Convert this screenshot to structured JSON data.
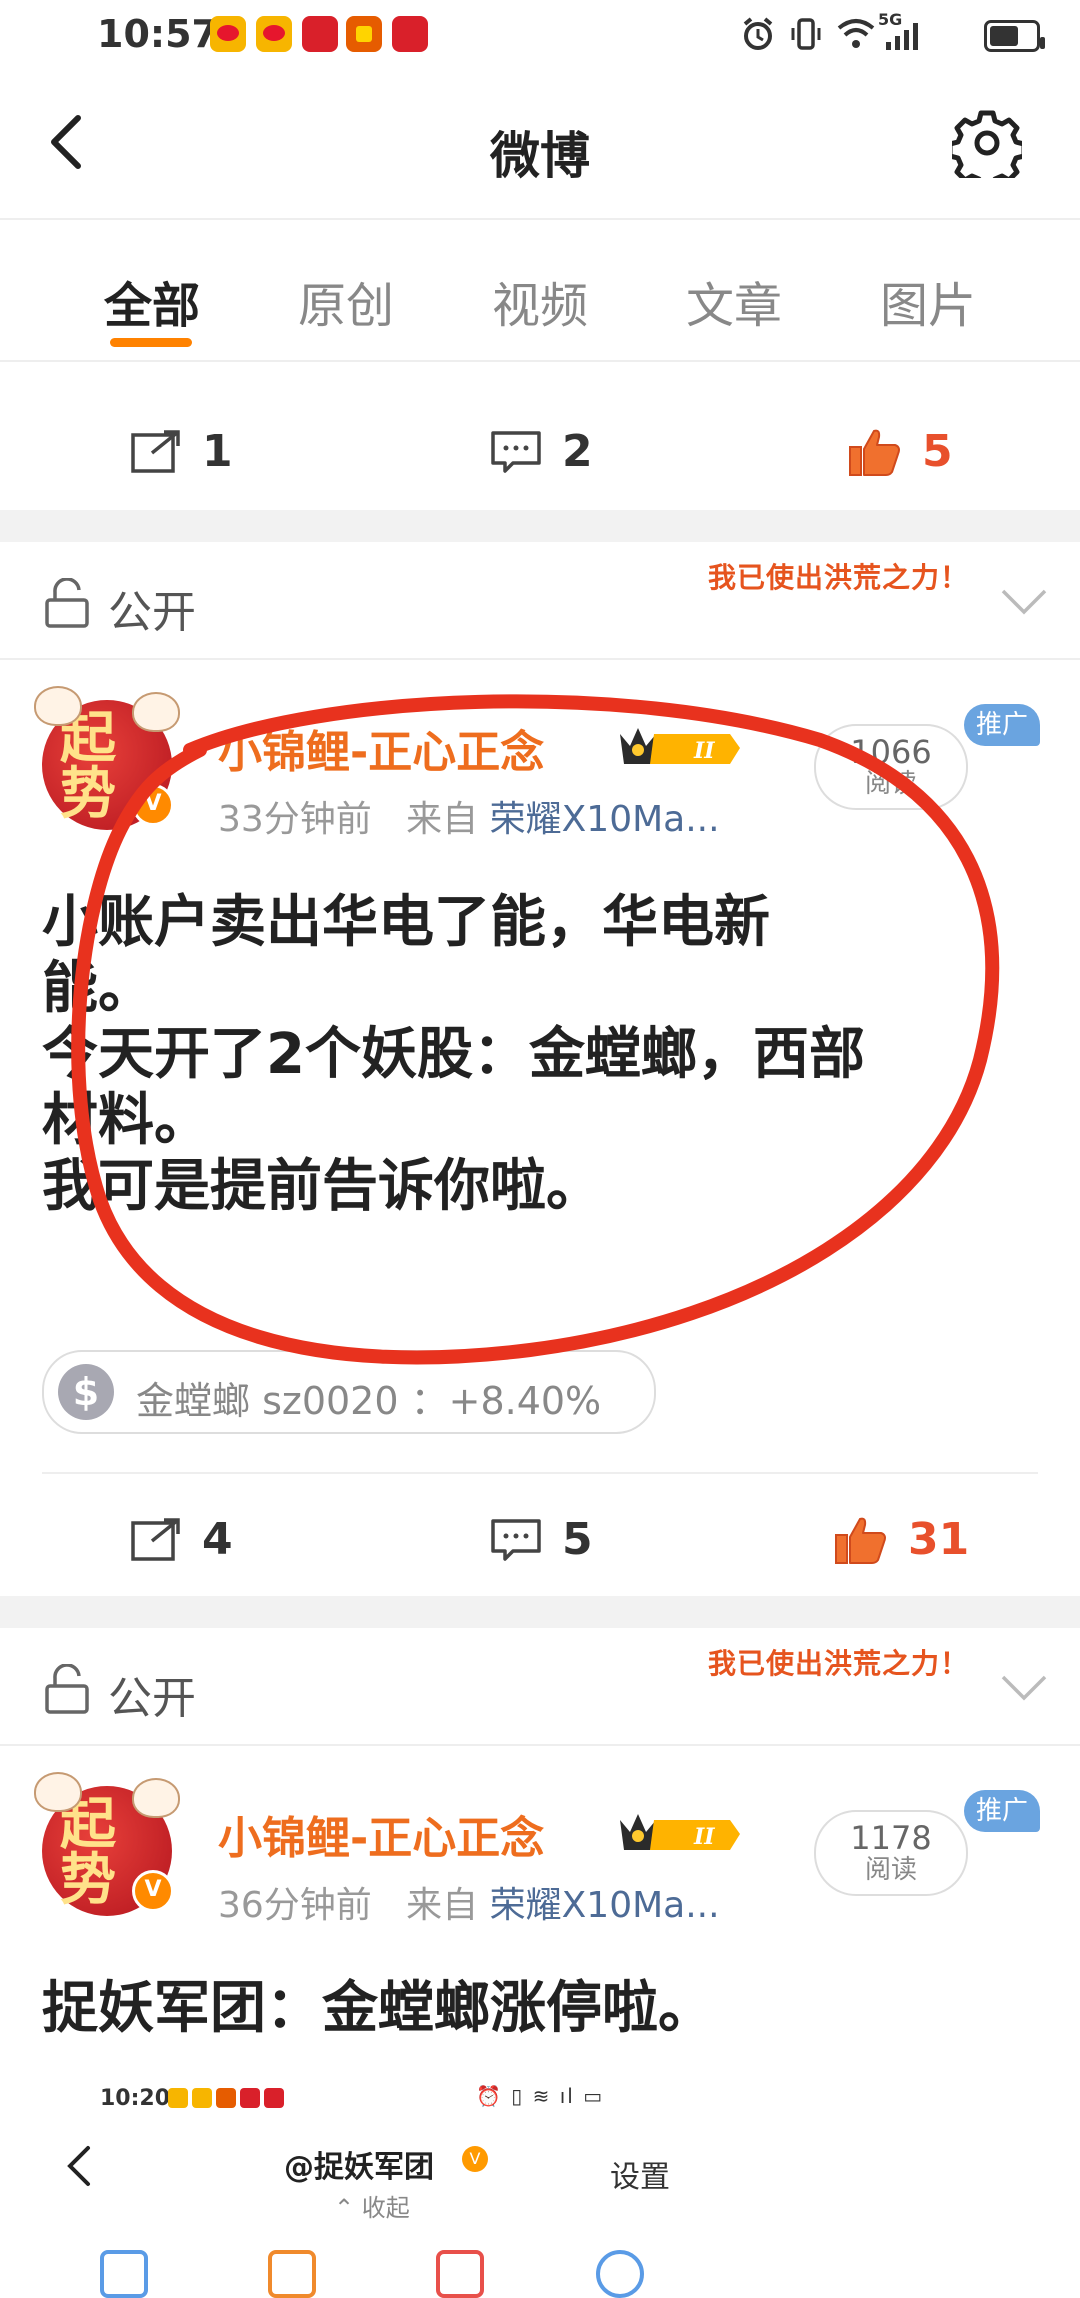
{
  "status_bar": {
    "time": "10:57",
    "network": "5G",
    "icons": [
      "weibo-icon",
      "weibo-icon",
      "app-icon",
      "red-packet-icon",
      "app-icon",
      "alarm-icon",
      "vibrate-icon",
      "wifi-icon",
      "signal-icon",
      "battery-icon"
    ]
  },
  "header": {
    "title": "微博",
    "back_icon": "back-arrow-icon",
    "settings_icon": "gear-icon"
  },
  "tabs": [
    {
      "label": "全部",
      "active": true
    },
    {
      "label": "原创",
      "active": false
    },
    {
      "label": "视频",
      "active": false
    },
    {
      "label": "文章",
      "active": false
    },
    {
      "label": "图片",
      "active": false
    }
  ],
  "colors": {
    "accent": "#ff8200",
    "like": "#e8502c",
    "username": "#ee6d1e",
    "source": "#4d6b96",
    "annotation": "#e8321e"
  },
  "prev_post": {
    "repost_count": "1",
    "comment_count": "2",
    "like_count": "5"
  },
  "posts": [
    {
      "visibility": "公开",
      "banner": "我已使出洪荒之力！",
      "avatar_text": "起势",
      "username": "小锦鲤-正心正念",
      "level": "II",
      "time": "33分钟前",
      "from_label": "来自",
      "source": "荣耀X10Ma...",
      "promo": "推广",
      "read_count": "1066",
      "read_label": "阅读",
      "text_lines": [
        "小账户卖出华电了能，华电新",
        "能。",
        "今天开了2个妖股：金螳螂，西部",
        "材料。",
        "我可是提前告诉你啦。"
      ],
      "stock_chip": {
        "icon": "$",
        "text": "金螳螂 sz0020    ：+8.40%"
      },
      "repost_count": "4",
      "comment_count": "5",
      "like_count": "31"
    },
    {
      "visibility": "公开",
      "banner": "我已使出洪荒之力！",
      "avatar_text": "起势",
      "username": "小锦鲤-正心正念",
      "level": "II",
      "time": "36分钟前",
      "from_label": "来自",
      "source": "荣耀X10Ma...",
      "promo": "推广",
      "read_count": "1178",
      "read_label": "阅读",
      "text_lines": [
        "捉妖军团：金螳螂涨停啦。"
      ]
    }
  ],
  "inset": {
    "time": "10:20",
    "title": "@捉妖军团",
    "collapse": "收起",
    "settings": "设置"
  }
}
